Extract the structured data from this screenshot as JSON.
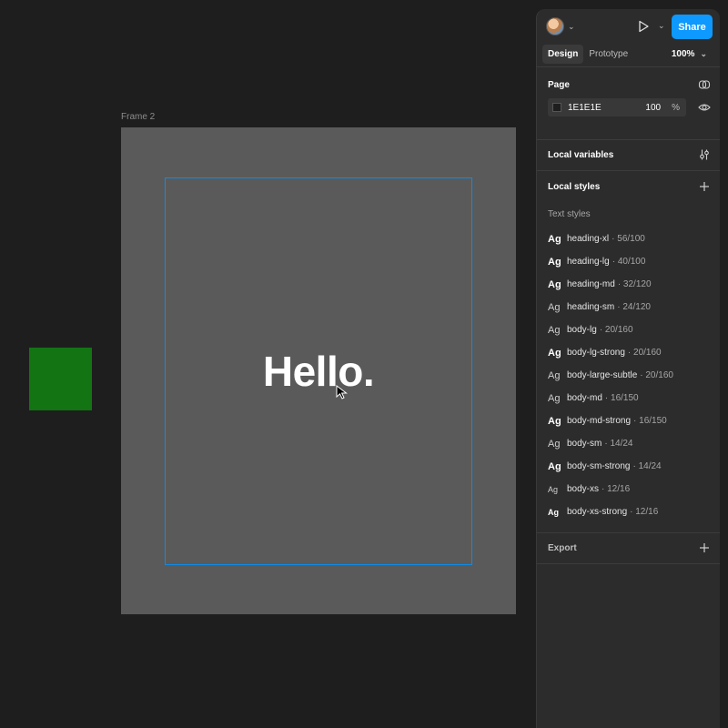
{
  "canvas": {
    "frame_label": "Frame 2",
    "hello_text": "Hello.",
    "frame_fill": "#5A5A5A",
    "selection_color": "#0C8CE9",
    "green_square_color": "#137413"
  },
  "toolbar": {
    "share_label": "Share",
    "share_color": "#0D99FF",
    "tabs": [
      {
        "label": "Design",
        "active": true
      },
      {
        "label": "Prototype",
        "active": false
      }
    ],
    "zoom": "100%"
  },
  "page": {
    "title": "Page",
    "bg_hex": "1E1E1E",
    "opacity": "100",
    "opacity_unit": "%"
  },
  "local_variables": {
    "title": "Local variables"
  },
  "local_styles": {
    "title": "Local styles",
    "subhead": "Text styles",
    "items": [
      {
        "name": "heading-xl",
        "meta": "· 56/100",
        "ag_style": "bold"
      },
      {
        "name": "heading-lg",
        "meta": "· 40/100",
        "ag_style": "bold"
      },
      {
        "name": "heading-md",
        "meta": "· 32/120",
        "ag_style": "bold"
      },
      {
        "name": "heading-sm",
        "meta": "· 24/120",
        "ag_style": "reg"
      },
      {
        "name": "body-lg",
        "meta": "· 20/160",
        "ag_style": "reg"
      },
      {
        "name": "body-lg-strong",
        "meta": "· 20/160",
        "ag_style": "bold"
      },
      {
        "name": "body-large-subtle",
        "meta": "· 20/160",
        "ag_style": "reg"
      },
      {
        "name": "body-md",
        "meta": "· 16/150",
        "ag_style": "reg"
      },
      {
        "name": "body-md-strong",
        "meta": "· 16/150",
        "ag_style": "bold"
      },
      {
        "name": "body-sm",
        "meta": "· 14/24",
        "ag_style": "reg"
      },
      {
        "name": "body-sm-strong",
        "meta": "· 14/24",
        "ag_style": "bold"
      },
      {
        "name": "body-xs",
        "meta": "· 12/16",
        "ag_style": "small"
      },
      {
        "name": "body-xs-strong",
        "meta": "· 12/16",
        "ag_style": "small bold"
      }
    ]
  },
  "export": {
    "title": "Export"
  },
  "icons": {
    "ag_glyph": "Ag"
  }
}
